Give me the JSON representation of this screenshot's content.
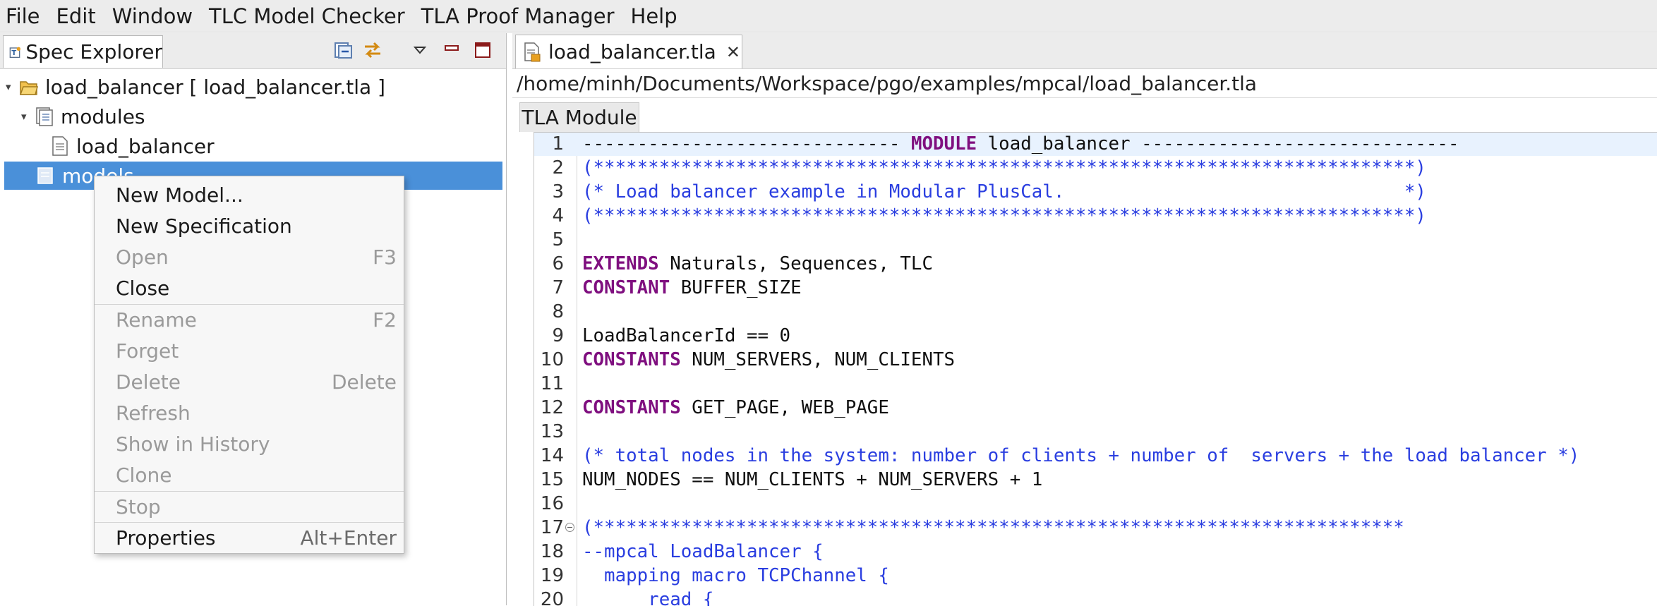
{
  "menubar": {
    "items": [
      "File",
      "Edit",
      "Window",
      "TLC Model Checker",
      "TLA Proof Manager",
      "Help"
    ]
  },
  "left_view": {
    "tab_label": "Spec Explorer",
    "toolbar_icons": [
      "collapse-all-icon",
      "link-with-editor-icon",
      "view-menu-icon",
      "minimize-icon",
      "maximize-icon"
    ],
    "tree": {
      "spec": "load_balancer [ load_balancer.tla ]",
      "modules_folder": "modules",
      "module_item": "load_balancer",
      "models_folder": "models"
    }
  },
  "context_menu": {
    "items": [
      {
        "label": "New Model...",
        "accel": "",
        "enabled": true
      },
      {
        "label": "New Specification",
        "accel": "",
        "enabled": true
      },
      {
        "label": "Open",
        "accel": "F3",
        "enabled": false
      },
      {
        "label": "Close",
        "accel": "",
        "enabled": true
      },
      {
        "label": "Rename",
        "accel": "F2",
        "enabled": false
      },
      {
        "label": "Forget",
        "accel": "",
        "enabled": false
      },
      {
        "label": "Delete",
        "accel": "Delete",
        "enabled": false
      },
      {
        "label": "Refresh",
        "accel": "",
        "enabled": false
      },
      {
        "label": "Show in History",
        "accel": "",
        "enabled": false
      },
      {
        "label": "Clone",
        "accel": "",
        "enabled": false
      },
      {
        "label": "Stop",
        "accel": "",
        "enabled": false
      },
      {
        "label": "Properties",
        "accel": "Alt+Enter",
        "enabled": true
      }
    ]
  },
  "editor": {
    "tab_label": "load_balancer.tla",
    "file_path": "/home/minh/Documents/Workspace/pgo/examples/mpcal/load_balancer.tla",
    "page_tab": "TLA Module",
    "lines": [
      {
        "n": "1",
        "segs": [
          {
            "t": "----------------------------- ",
            "c": "normal"
          },
          {
            "t": "MODULE",
            "c": "keyword"
          },
          {
            "t": " load_balancer -----------------------------",
            "c": "normal"
          }
        ]
      },
      {
        "n": "2",
        "segs": [
          {
            "t": "(***************************************************************************)",
            "c": "comment"
          }
        ]
      },
      {
        "n": "3",
        "segs": [
          {
            "t": "(* Load balancer example in Modular PlusCal.                               *)",
            "c": "comment"
          }
        ]
      },
      {
        "n": "4",
        "segs": [
          {
            "t": "(***************************************************************************)",
            "c": "comment"
          }
        ]
      },
      {
        "n": "5",
        "segs": []
      },
      {
        "n": "6",
        "segs": [
          {
            "t": "EXTENDS",
            "c": "keyword"
          },
          {
            "t": " Naturals, Sequences, TLC",
            "c": "normal"
          }
        ]
      },
      {
        "n": "7",
        "segs": [
          {
            "t": "CONSTANT",
            "c": "keyword"
          },
          {
            "t": " BUFFER_SIZE",
            "c": "normal"
          }
        ]
      },
      {
        "n": "8",
        "segs": []
      },
      {
        "n": "9",
        "segs": [
          {
            "t": "LoadBalancerId == 0",
            "c": "normal"
          }
        ]
      },
      {
        "n": "10",
        "segs": [
          {
            "t": "CONSTANTS",
            "c": "keyword"
          },
          {
            "t": " NUM_SERVERS, NUM_CLIENTS",
            "c": "normal"
          }
        ]
      },
      {
        "n": "11",
        "segs": []
      },
      {
        "n": "12",
        "segs": [
          {
            "t": "CONSTANTS",
            "c": "keyword"
          },
          {
            "t": " GET_PAGE, WEB_PAGE",
            "c": "normal"
          }
        ]
      },
      {
        "n": "13",
        "segs": []
      },
      {
        "n": "14",
        "segs": [
          {
            "t": "(* total nodes in the system: number of clients + number of  servers + the load balancer *)",
            "c": "comment"
          }
        ]
      },
      {
        "n": "15",
        "segs": [
          {
            "t": "NUM_NODES == NUM_CLIENTS + NUM_SERVERS + 1",
            "c": "normal"
          }
        ]
      },
      {
        "n": "16",
        "segs": []
      },
      {
        "n": "17",
        "segs": [
          {
            "t": "(**************************************************************************",
            "c": "comment"
          }
        ]
      },
      {
        "n": "18",
        "segs": [
          {
            "t": "--mpcal LoadBalancer {",
            "c": "comment"
          }
        ]
      },
      {
        "n": "19",
        "segs": [
          {
            "t": "  mapping macro TCPChannel {",
            "c": "comment"
          }
        ]
      },
      {
        "n": "20",
        "segs": [
          {
            "t": "      read {",
            "c": "comment"
          }
        ]
      }
    ]
  }
}
